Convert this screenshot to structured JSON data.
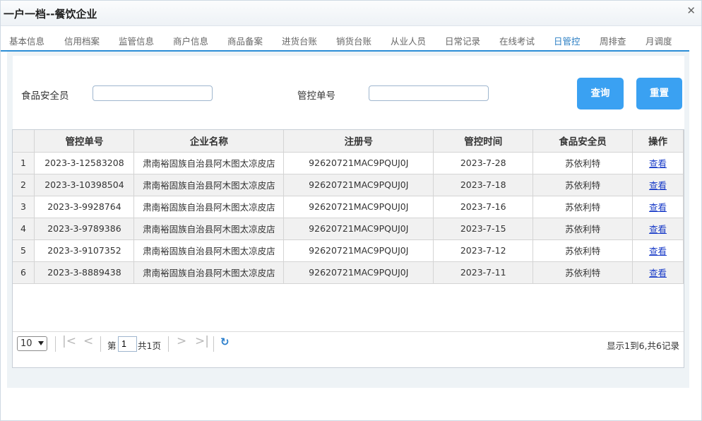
{
  "window": {
    "title": "一户一档--餐饮企业",
    "close_icon": "close-icon"
  },
  "tabs": [
    {
      "label": "基本信息"
    },
    {
      "label": "信用档案"
    },
    {
      "label": "监管信息"
    },
    {
      "label": "商户信息"
    },
    {
      "label": "商品备案"
    },
    {
      "label": "进货台账"
    },
    {
      "label": "销货台账"
    },
    {
      "label": "从业人员"
    },
    {
      "label": "日常记录"
    },
    {
      "label": "在线考试"
    },
    {
      "label": "日管控"
    },
    {
      "label": "周排查"
    },
    {
      "label": "月调度"
    }
  ],
  "active_tab": "日管控",
  "search": {
    "safety_officer_label": "食品安全员",
    "safety_officer_value": "",
    "control_no_label": "管控单号",
    "control_no_value": "",
    "query_label": "查询",
    "reset_label": "重置"
  },
  "table": {
    "columns": [
      "管控单号",
      "企业名称",
      "注册号",
      "管控时间",
      "食品安全员",
      "操作"
    ],
    "rows": [
      {
        "n": "1",
        "no": "2023-3-12583208",
        "name": "肃南裕固族自治县阿木图太凉皮店",
        "reg": "92620721MAC9PQUJ0J",
        "date": "2023-7-28",
        "officer": "苏依利特",
        "op": "查看"
      },
      {
        "n": "2",
        "no": "2023-3-10398504",
        "name": "肃南裕固族自治县阿木图太凉皮店",
        "reg": "92620721MAC9PQUJ0J",
        "date": "2023-7-18",
        "officer": "苏依利特",
        "op": "查看"
      },
      {
        "n": "3",
        "no": "2023-3-9928764",
        "name": "肃南裕固族自治县阿木图太凉皮店",
        "reg": "92620721MAC9PQUJ0J",
        "date": "2023-7-16",
        "officer": "苏依利特",
        "op": "查看"
      },
      {
        "n": "4",
        "no": "2023-3-9789386",
        "name": "肃南裕固族自治县阿木图太凉皮店",
        "reg": "92620721MAC9PQUJ0J",
        "date": "2023-7-15",
        "officer": "苏依利特",
        "op": "查看"
      },
      {
        "n": "5",
        "no": "2023-3-9107352",
        "name": "肃南裕固族自治县阿木图太凉皮店",
        "reg": "92620721MAC9PQUJ0J",
        "date": "2023-7-12",
        "officer": "苏依利特",
        "op": "查看"
      },
      {
        "n": "6",
        "no": "2023-3-8889438",
        "name": "肃南裕固族自治县阿木图太凉皮店",
        "reg": "92620721MAC9PQUJ0J",
        "date": "2023-7-11",
        "officer": "苏依利特",
        "op": "查看"
      }
    ]
  },
  "pager": {
    "page_size": "10",
    "page_prefix": "第",
    "page_value": "1",
    "page_suffix": "共1页",
    "info": "显示1到6,共6记录"
  },
  "colors": {
    "accent": "#2c8ed6",
    "button": "#3aa1f2",
    "link": "#1a3cc8"
  }
}
